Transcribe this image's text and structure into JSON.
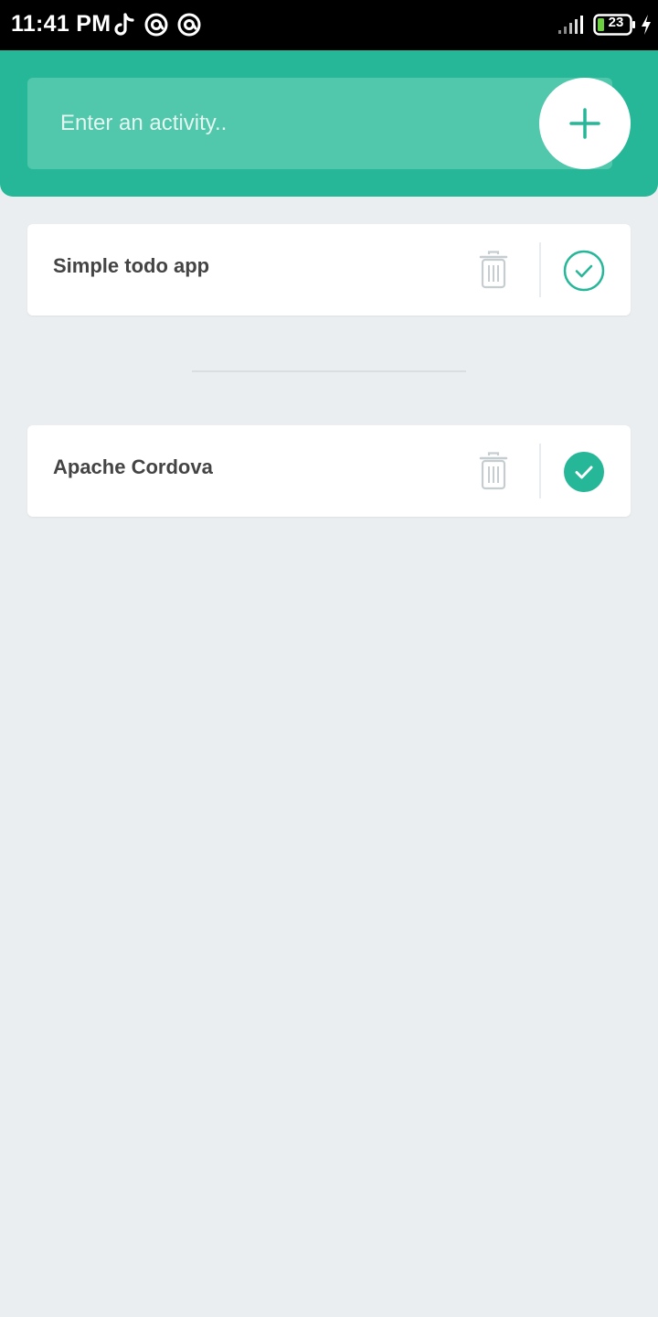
{
  "status_bar": {
    "time": "11:41 PM",
    "battery_level": "23",
    "left_icons": [
      "tiktok-icon",
      "at-sign-icon",
      "at-sign-icon"
    ],
    "right_icons": [
      "signal-icon",
      "battery-icon",
      "charging-icon"
    ]
  },
  "header": {
    "input_placeholder": "Enter an activity..",
    "input_value": "",
    "add_icon": "plus-icon"
  },
  "todo_list": {
    "items": [
      {
        "label": "Simple todo app",
        "completed": false
      }
    ]
  },
  "completed_list": {
    "items": [
      {
        "label": "Apache Cordova",
        "completed": true
      }
    ]
  },
  "colors": {
    "accent": "#25b797",
    "input_bg": "#51c7ab",
    "background": "#eaeef0",
    "trash": "#c5cdd0"
  }
}
